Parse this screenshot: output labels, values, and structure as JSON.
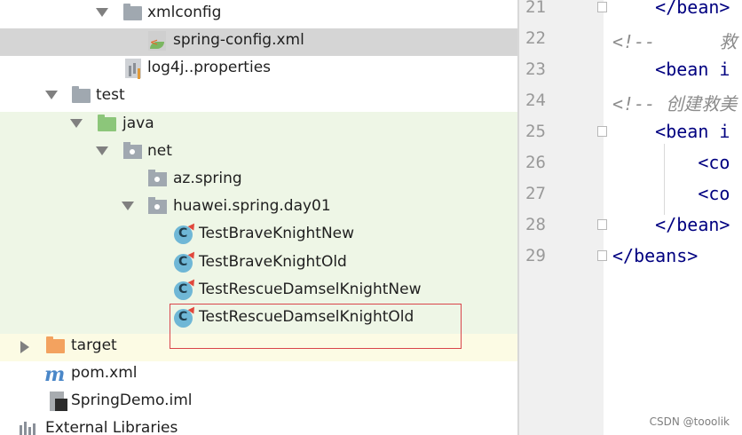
{
  "project_tree": {
    "rows": [
      {
        "label": "xmlconfig",
        "icon": "folder-icon"
      },
      {
        "label": "spring-config.xml",
        "icon": "xml-file-icon"
      },
      {
        "label": "log4j..properties",
        "icon": "properties-file-icon"
      },
      {
        "label": "test",
        "icon": "folder-icon"
      },
      {
        "label": "java",
        "icon": "source-folder-icon"
      },
      {
        "label": "net",
        "icon": "package-icon"
      },
      {
        "label": "az.spring",
        "icon": "package-icon"
      },
      {
        "label": "huawei.spring.day01",
        "icon": "package-icon"
      },
      {
        "label": "TestBraveKnightNew",
        "icon": "class-icon"
      },
      {
        "label": "TestBraveKnightOld",
        "icon": "class-icon"
      },
      {
        "label": "TestRescueDamselKnightNew",
        "icon": "class-icon"
      },
      {
        "label": "TestRescueDamselKnightOld",
        "icon": "class-icon"
      },
      {
        "label": "target",
        "icon": "excluded-folder-icon"
      },
      {
        "label": "pom.xml",
        "icon": "maven-icon"
      },
      {
        "label": "SpringDemo.iml",
        "icon": "iml-file-icon"
      },
      {
        "label": "External Libraries",
        "icon": "library-icon"
      }
    ],
    "class_letter": "C",
    "pom_letter": "m"
  },
  "editor": {
    "line_numbers": [
      "21",
      "22",
      "23",
      "24",
      "25",
      "26",
      "27",
      "28",
      "29"
    ],
    "lines": [
      "    </bean>",
      "<!--      救",
      "    <bean i",
      "<!-- 创建救美",
      "    <bean i",
      "        <co",
      "        <co",
      "    </bean>",
      "</beans>"
    ]
  },
  "watermark": "CSDN @tooolik",
  "colors": {
    "test_highlight": "#eef6e6",
    "selected_row": "#d5d5d5",
    "target_highlight": "#fcfbe4",
    "annotation_box": "#d9454b",
    "xml_tag": "#000080",
    "comment": "#8c8c8c"
  }
}
